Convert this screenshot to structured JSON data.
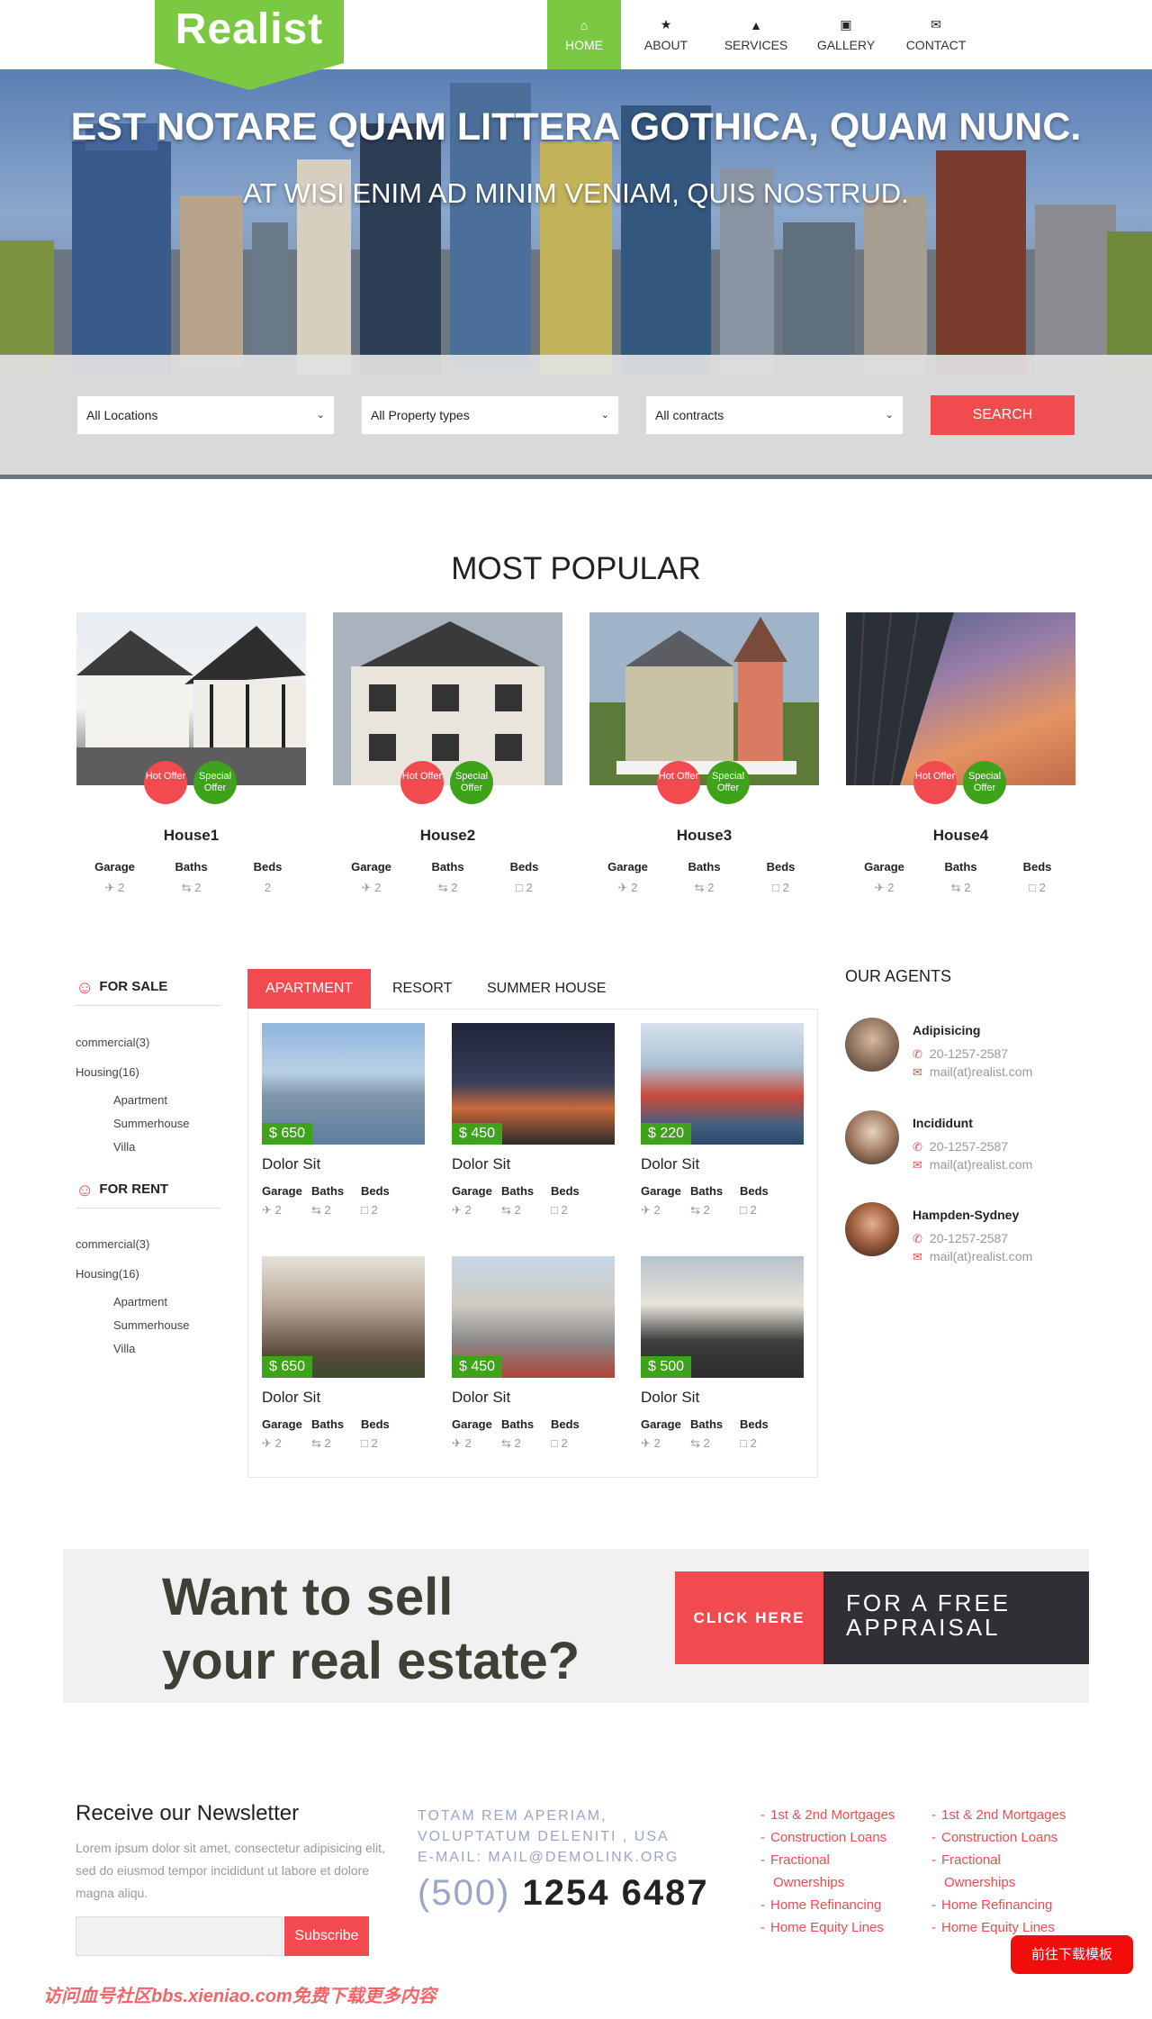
{
  "brand": {
    "logo": "Realist",
    "accent": "#7bc943",
    "red": "#f24b4f",
    "green": "#3ea31a"
  },
  "nav": [
    {
      "label": "HOME",
      "icon": "home-icon",
      "active": true
    },
    {
      "label": "ABOUT",
      "icon": "star-icon"
    },
    {
      "label": "SERVICES",
      "icon": "thumbs-up-icon"
    },
    {
      "label": "GALLERY",
      "icon": "image-icon"
    },
    {
      "label": "CONTACT",
      "icon": "envelope-icon"
    }
  ],
  "hero": {
    "title": "EST NOTARE QUAM LITTERA GOTHICA, QUAM NUNC.",
    "subtitle": "AT WISI ENIM AD MINIM VENIAM, QUIS NOSTRUD."
  },
  "search": {
    "location": "All Locations",
    "property_type": "All Property types",
    "contract": "All contracts",
    "button": "SEARCH"
  },
  "most_popular": {
    "title": "MOST POPULAR",
    "badge_hot": "Hot Offer",
    "badge_special": "Special Offer",
    "features": [
      "Garage",
      "Baths",
      "Beds"
    ],
    "items": [
      {
        "name": "House1",
        "values": [
          "2",
          "2",
          "2"
        ]
      },
      {
        "name": "House2",
        "values": [
          "2",
          "2",
          "2"
        ]
      },
      {
        "name": "House3",
        "values": [
          "2",
          "2",
          "2"
        ]
      },
      {
        "name": "House4",
        "values": [
          "2",
          "2",
          "2"
        ]
      }
    ]
  },
  "sidebar": {
    "for_sale": "FOR SALE",
    "for_rent": "FOR RENT",
    "commercial": "commercial(3)",
    "housing": "Housing(16)",
    "sub": [
      "Apartment",
      "Summerhouse",
      "Villa"
    ]
  },
  "tabs": [
    "APARTMENT",
    "RESORT",
    "SUMMER HOUSE"
  ],
  "listings": {
    "features": [
      "Garage",
      "Baths",
      "Beds"
    ],
    "items": [
      {
        "name": "Dolor Sit",
        "price": "$ 650",
        "values": [
          "2",
          "2",
          "2"
        ]
      },
      {
        "name": "Dolor Sit",
        "price": "$ 450",
        "values": [
          "2",
          "2",
          "2"
        ]
      },
      {
        "name": "Dolor Sit",
        "price": "$ 220",
        "values": [
          "2",
          "2",
          "2"
        ]
      },
      {
        "name": "Dolor Sit",
        "price": "$ 650",
        "values": [
          "2",
          "2",
          "2"
        ]
      },
      {
        "name": "Dolor Sit",
        "price": "$ 450",
        "values": [
          "2",
          "2",
          "2"
        ]
      },
      {
        "name": "Dolor Sit",
        "price": "$ 500",
        "values": [
          "2",
          "2",
          "2"
        ]
      }
    ]
  },
  "agents": {
    "title": "OUR AGENTS",
    "items": [
      {
        "name": "Adipisicing",
        "phone": "20-1257-2587",
        "email": "mail(at)realist.com"
      },
      {
        "name": "Incididunt",
        "phone": "20-1257-2587",
        "email": "mail(at)realist.com"
      },
      {
        "name": "Hampden-Sydney",
        "phone": "20-1257-2587",
        "email": "mail(at)realist.com"
      }
    ]
  },
  "cta": {
    "title_line1": "Want to sell",
    "title_line2": "your real estate?",
    "click": "CLICK HERE",
    "free_line1": "FOR A FREE",
    "free_line2": "APPRAISAL"
  },
  "newsletter": {
    "title": "Receive our Newsletter",
    "text": "Lorem ipsum dolor sit amet, consectetur adipisicing elit, sed do eiusmod tempor incididunt ut labore et dolore magna aliqu.",
    "input_value": "",
    "button": "Subscribe"
  },
  "contact": {
    "line1": "TOTAM REM APERIAM,",
    "line2": "VOLUPTATUM DELENITI , USA",
    "line3": "E-MAIL: MAIL@DEMOLINK.ORG",
    "phone_area": "(500)",
    "phone_number": "1254 6487"
  },
  "footer_links": {
    "col1": [
      "1st & 2nd Mortgages",
      "Construction Loans",
      "Fractional",
      "Ownerships",
      "Home Refinancing",
      "Home Equity Lines"
    ],
    "col2": [
      "1st & 2nd Mortgages",
      "Construction Loans",
      "Fractional",
      "Ownerships",
      "Home Refinancing",
      "Home Equity Lines"
    ]
  },
  "download_button": "前往下载模板",
  "watermark": "访问血号社区bbs.xieniao.com免费下载更多内容"
}
